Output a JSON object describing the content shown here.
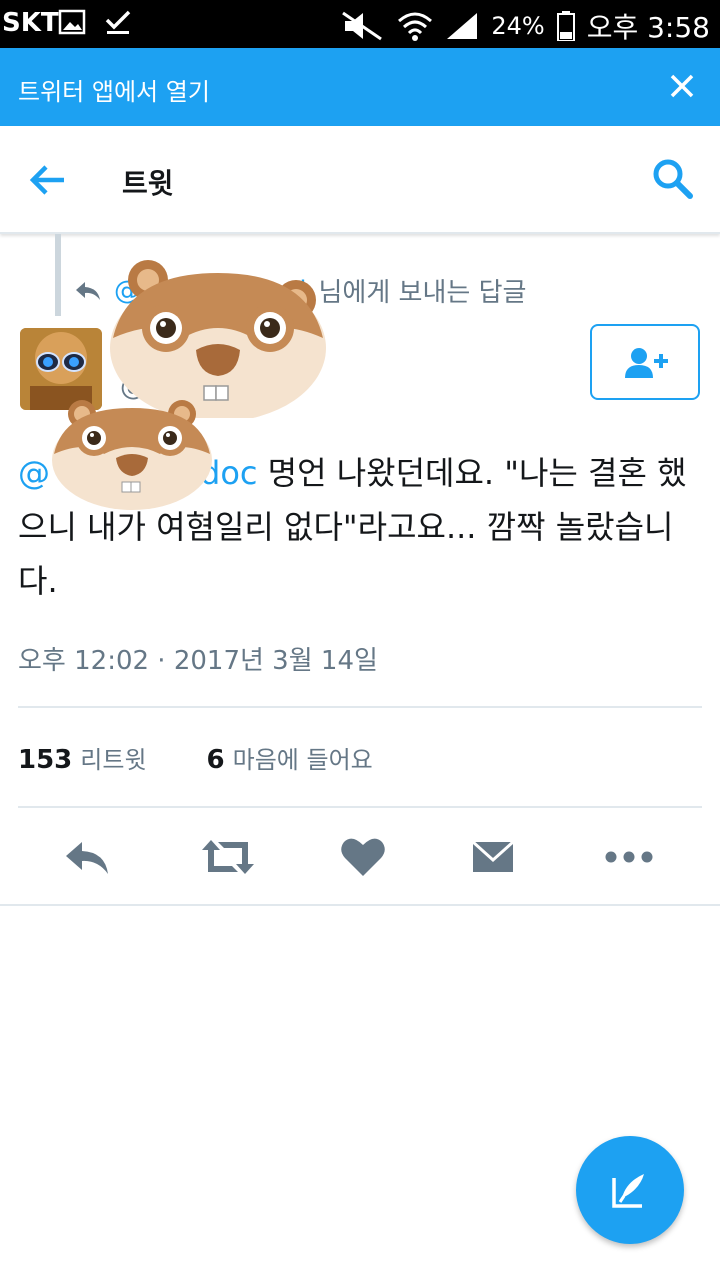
{
  "status_bar": {
    "carrier": "SKT",
    "battery": "24%",
    "time": "오후 3:58"
  },
  "banner": {
    "label": "트위터 앱에서 열기"
  },
  "nav": {
    "title": "트윗"
  },
  "tweet": {
    "reply_prefix": "@",
    "reply_handle_visible": "d",
    "reply_suffix": "님에게 보내는 답글",
    "handle_prefix": "@",
    "mention_prefix": "@",
    "mention_visible": "doc",
    "text_after_mention": " 명언 나왔던데요. \"나는 결혼 했으니 내가 여혐일리 없다\"라고요...  깜짝 놀랐습니다.",
    "timestamp": "오후 12:02 · 2017년 3월 14일",
    "retweets_count": "153",
    "retweets_label": "리트윗",
    "likes_count": "6",
    "likes_label": "마음에 들어요"
  },
  "icons": {
    "actions": [
      "reply-icon",
      "retweet-icon",
      "heart-icon",
      "message-icon",
      "more-icon"
    ],
    "accent": "#1da1f2",
    "action_color": "#657786"
  }
}
